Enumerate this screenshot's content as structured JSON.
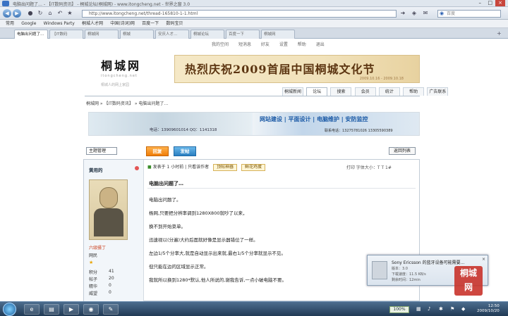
{
  "browser": {
    "window_title": "电脑出问题了… - 【IT数码资讯】 - 桐城论坛(桐城网) - www.itongcheng.net - 世界之窗 3.0",
    "address_url": "http://www.itongcheng.net/thread-165810-1-1.html",
    "search_placeholder": "百度",
    "bookmarks": [
      "常用",
      "Google",
      "Windows Party",
      "桐城人才网",
      "中国(诗词)网",
      "百度一下",
      "数码宝贝"
    ],
    "tabs": [
      "电脑出问题了…",
      "【IT数码",
      "桐城网",
      "桐城",
      "安庆人才…",
      "桐城论坛",
      "百度一下",
      "桐城网"
    ]
  },
  "site": {
    "top_links": [
      "我的空间",
      "短消息",
      "好友",
      "设置",
      "帮助",
      "退出"
    ],
    "logo_text": "桐城网",
    "logo_sub": "itongcheng.net",
    "logo_tagline": "桐城人的网上家园",
    "banner_title": "热烈庆祝2009首届中国桐城文化节",
    "banner_dates": "2009.10.16 - 2009.10.18",
    "menu": [
      "桐城新闻",
      "论坛",
      "搜索",
      "会员",
      "统计",
      "帮助",
      "广告联系"
    ],
    "breadcrumb": "桐城网 » 【IT数码资讯】 » 电脑出问题了…",
    "ad1_contact": "电话：13909601014    QQ：1141318",
    "ad2_heading": "网站建设 | 平面设计 | 电脑维护 | 安防监控",
    "ad2_contact": "联系电话：13275781026  13305590389"
  },
  "toolbar": {
    "page_select": "主题管理",
    "reply_label": "回复",
    "post_label": "发帖",
    "back_label": "返回列表"
  },
  "post": {
    "author": "黄用的",
    "rank_title": "六级骚丁",
    "rank_sub": "网民",
    "stats": [
      {
        "label": "积分",
        "value": "41"
      },
      {
        "label": "帖子",
        "value": "20"
      },
      {
        "label": "精华",
        "value": "0"
      },
      {
        "label": "威望",
        "value": "0"
      }
    ],
    "meta_posted": "发表于 1 小时前",
    "meta_author_only": "只看该作者",
    "meta_badge1": "顶帖神器",
    "meta_badge2": "鲜花鸡蛋",
    "meta_right": "打印   字体大小：T  T  1#",
    "title": "电脑出问题了…",
    "lines": [
      "电脑出问题了。",
      "杨网,只要把分辨率调到1280X800就吵了以来，",
      "换不到开始菜单。",
      "迅速视以(分遍)大约后面就好像是显示器错位了一样。",
      "左边1/5个分率大,就是自动显示出来就,最右1/5个分率就显示不见。",
      "但只能在边的区域显示正常。",
      "我就所以换到1280*默认,他人所说的,谢我告诉,一点小破电脑不要。"
    ]
  },
  "notification": {
    "title": "Sony Ericsson 的蓝牙设备可能需要…",
    "lines": [
      "版本：3.0",
      "下载速度：11.5 KB/s",
      "剩余时间：12min"
    ]
  },
  "taskbar": {
    "zoom": "100%",
    "time": "12:50",
    "date": "2009/10/20"
  }
}
